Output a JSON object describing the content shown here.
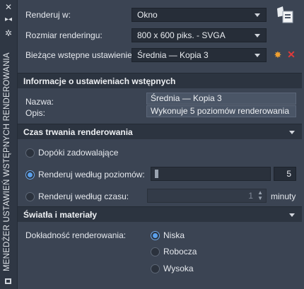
{
  "sidebar": {
    "title": "MENEDŻER USTAWIEŃ WSTĘPNYCH RENDEROWANIA"
  },
  "top": {
    "render_in_label": "Renderuj w:",
    "render_in_value": "Okno",
    "render_size_label": "Rozmiar renderingu:",
    "render_size_value": "800 x 600 piks. - SVGA",
    "current_preset_label": "Bieżące wstępne ustawienie:",
    "current_preset_value": "Średnia — Kopia 3"
  },
  "preset_info": {
    "header": "Informacje o ustawieniach wstępnych",
    "name_label": "Nazwa:",
    "name_value": "Średnia — Kopia 3",
    "desc_label": "Opis:",
    "desc_value": "Wykonuje 5 poziomów renderowania"
  },
  "duration": {
    "header": "Czas trwania renderowania",
    "until_satisfactory": "Dopóki zadowalające",
    "by_levels": "Renderuj według poziomów:",
    "levels_value": "5",
    "by_time": "Renderuj według czasu:",
    "time_value": "1",
    "time_unit": "minuty"
  },
  "lights": {
    "header": "Światła i materiały",
    "accuracy_label": "Dokładność renderowania:",
    "options": [
      "Niska",
      "Robocza",
      "Wysoka"
    ],
    "selected": "Niska"
  },
  "colors": {
    "accent": "#5aa0ec",
    "delete": "#e03a3a",
    "new": "#f0a030"
  }
}
